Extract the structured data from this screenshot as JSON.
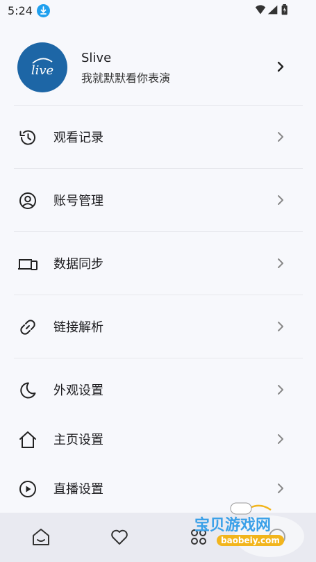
{
  "status": {
    "time": "5:24"
  },
  "profile": {
    "name": "Slive",
    "signature": "我就默默看你表演",
    "avatar_text": "live"
  },
  "menu": [
    {
      "label": "观看记录",
      "icon": "history-icon"
    },
    {
      "label": "账号管理",
      "icon": "account-icon"
    },
    {
      "label": "数据同步",
      "icon": "devices-sync-icon"
    },
    {
      "label": "链接解析",
      "icon": "link-icon"
    },
    {
      "label": "外观设置",
      "icon": "moon-icon"
    },
    {
      "label": "主页设置",
      "icon": "home-outline-icon"
    },
    {
      "label": "直播设置",
      "icon": "play-circle-icon"
    }
  ],
  "tabbar": [
    "home-tab-icon",
    "heart-tab-icon",
    "category-tab-icon",
    "profile-tab-icon"
  ],
  "watermark": {
    "title": "宝贝游戏网",
    "url": "baobeiy.com"
  },
  "colors": {
    "background": "#f7f8fc",
    "tabbar": "#e9eaf1",
    "avatar": "#1d66a6",
    "accent": "#1fa0ef"
  }
}
